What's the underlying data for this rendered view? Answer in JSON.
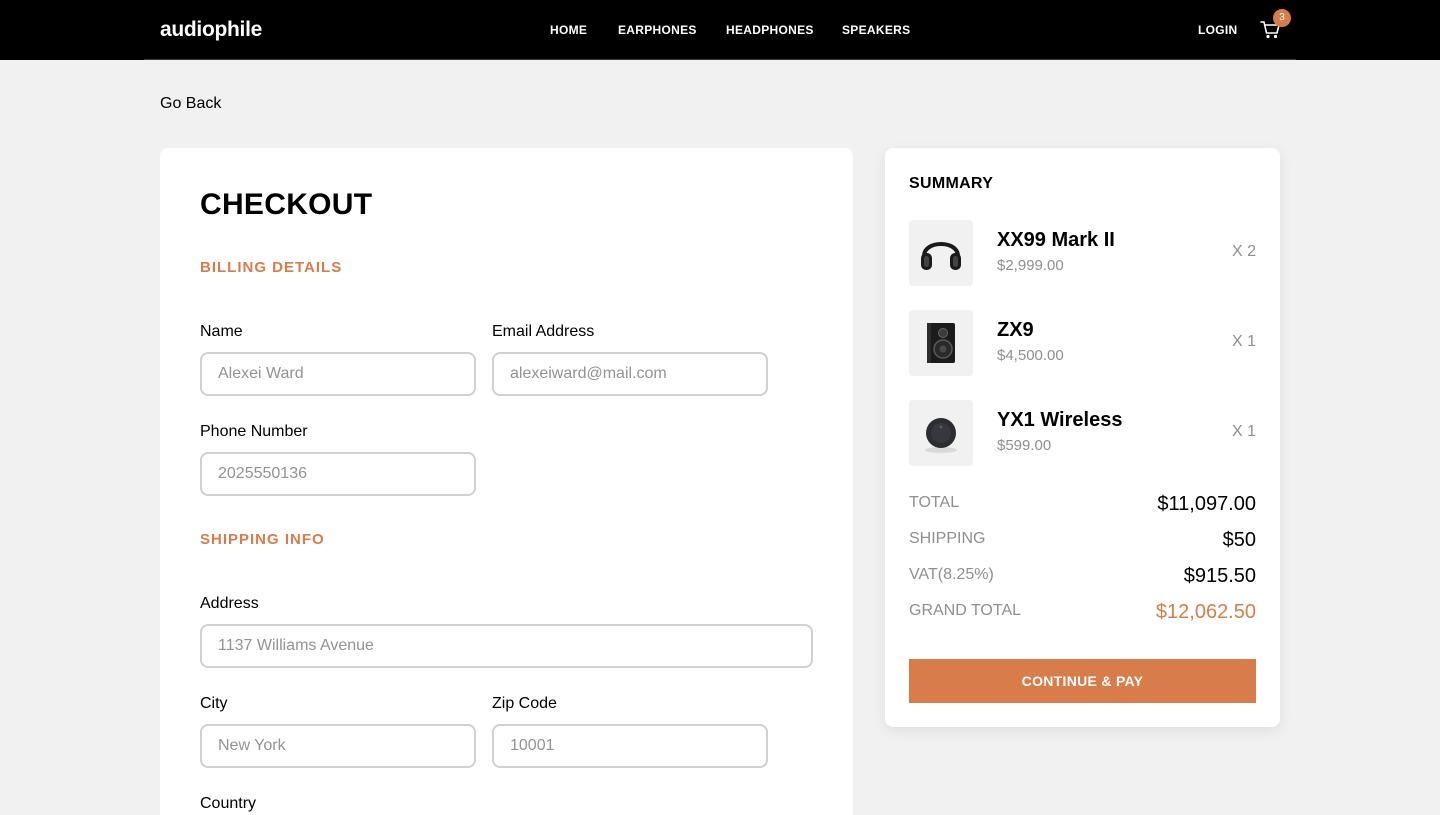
{
  "header": {
    "logo": "audiophile",
    "nav": [
      "HOME",
      "EARPHONES",
      "HEADPHONES",
      "SPEAKERS"
    ],
    "login_label": "LOGIN",
    "cart_count": "3",
    "cart_icon": "cart-icon"
  },
  "go_back_label": "Go Back",
  "checkout": {
    "title": "CHECKOUT",
    "billing": {
      "title": "BILLING DETAILS",
      "name_label": "Name",
      "name_placeholder": "Alexei Ward",
      "email_label": "Email Address",
      "email_placeholder": "alexeiward@mail.com",
      "phone_label": "Phone Number",
      "phone_placeholder": "2025550136"
    },
    "shipping": {
      "title": "SHIPPING INFO",
      "address_label": "Address",
      "address_placeholder": "1137 Williams Avenue",
      "city_label": "City",
      "city_placeholder": "New York",
      "zip_label": "Zip Code",
      "zip_placeholder": "10001",
      "country_label": "Country"
    }
  },
  "summary": {
    "title": "SUMMARY",
    "items": [
      {
        "name": "XX99 Mark II",
        "price": "$2,999.00",
        "qty": "X 2",
        "icon": "headphones-icon"
      },
      {
        "name": "ZX9",
        "price": "$4,500.00",
        "qty": "X 1",
        "icon": "speaker-icon"
      },
      {
        "name": "YX1 Wireless",
        "price": "$599.00",
        "qty": "X 1",
        "icon": "earphones-icon"
      }
    ],
    "totals": [
      {
        "label": "TOTAL",
        "value": "$11,097.00"
      },
      {
        "label": "SHIPPING",
        "value": "$50"
      },
      {
        "label": "VAT(8.25%)",
        "value": "$915.50"
      },
      {
        "label": "GRAND TOTAL",
        "value": "$12,062.50"
      }
    ],
    "pay_label": "CONTINUE & PAY"
  },
  "colors": {
    "accent": "#d87d4a",
    "header_bg": "#000000",
    "page_bg": "#f1f1f1"
  }
}
